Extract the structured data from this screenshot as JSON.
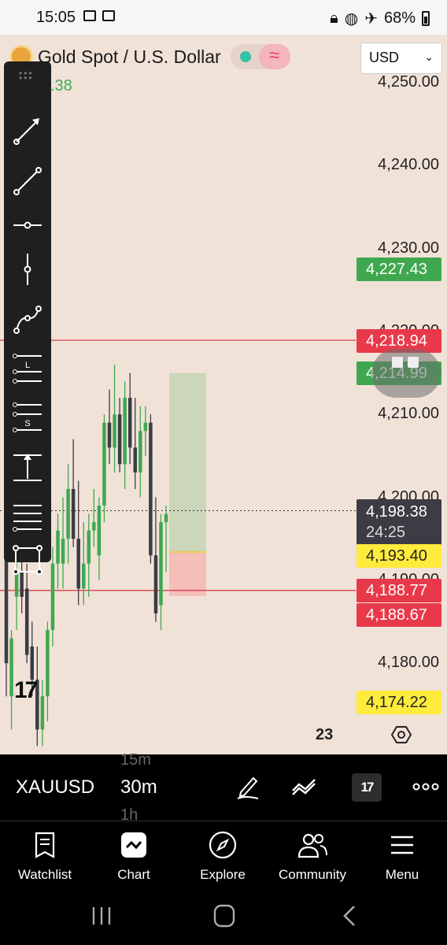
{
  "status_bar": {
    "time": "15:05",
    "battery": "68%"
  },
  "header": {
    "symbol_name": "Gold Spot / U.S. Dollar",
    "currency": "USD",
    "ohlc_fragment": ".38"
  },
  "price_axis": [
    "4,250.00",
    "4,240.00",
    "4,230.00",
    "4,220.00",
    "4,210.00",
    "4,200.00",
    "4,190.00",
    "4,180.00"
  ],
  "price_tags": {
    "tp_price": "4,227.43",
    "red_line_upper": "4,218.94",
    "green_level": "4,214.99",
    "last_price": "4,198.38",
    "countdown": "24:25",
    "entry": "4,193.40",
    "red_line_lower": "4,188.77",
    "stop": "4,188.67",
    "low_level": "4,174.22"
  },
  "chart_data": {
    "type": "candlestick",
    "symbol": "XAUUSD",
    "timeframe": "30m",
    "ylim": [
      4170,
      4252
    ],
    "horizontal_lines": [
      4218.94,
      4188.77
    ],
    "last_price": 4198.38,
    "candles": [
      {
        "o": 4200,
        "h": 4203,
        "l": 4176,
        "c": 4180
      },
      {
        "o": 4176,
        "h": 4184,
        "l": 4172,
        "c": 4183
      },
      {
        "o": 4188,
        "h": 4196,
        "l": 4184,
        "c": 4191
      },
      {
        "o": 4191,
        "h": 4195,
        "l": 4186,
        "c": 4188
      },
      {
        "o": 4189,
        "h": 4192,
        "l": 4180,
        "c": 4181
      },
      {
        "o": 4182,
        "h": 4185,
        "l": 4176,
        "c": 4178
      },
      {
        "o": 4178,
        "h": 4182,
        "l": 4170,
        "c": 4172
      },
      {
        "o": 4172,
        "h": 4178,
        "l": 4170,
        "c": 4176
      },
      {
        "o": 4176,
        "h": 4185,
        "l": 4173,
        "c": 4184
      },
      {
        "o": 4184,
        "h": 4194,
        "l": 4182,
        "c": 4192
      },
      {
        "o": 4192,
        "h": 4198,
        "l": 4189,
        "c": 4196
      },
      {
        "o": 4192,
        "h": 4200,
        "l": 4189,
        "c": 4195
      },
      {
        "o": 4195,
        "h": 4204,
        "l": 4192,
        "c": 4201
      },
      {
        "o": 4201,
        "h": 4207,
        "l": 4194,
        "c": 4195
      },
      {
        "o": 4195,
        "h": 4202,
        "l": 4187,
        "c": 4189
      },
      {
        "o": 4189,
        "h": 4197,
        "l": 4187,
        "c": 4192
      },
      {
        "o": 4192,
        "h": 4198,
        "l": 4188,
        "c": 4196
      },
      {
        "o": 4196,
        "h": 4201,
        "l": 4194,
        "c": 4197
      },
      {
        "o": 4193,
        "h": 4200,
        "l": 4190,
        "c": 4199
      },
      {
        "o": 4199,
        "h": 4210,
        "l": 4197,
        "c": 4209
      },
      {
        "o": 4209,
        "h": 4213,
        "l": 4204,
        "c": 4206
      },
      {
        "o": 4206,
        "h": 4216,
        "l": 4203,
        "c": 4210
      },
      {
        "o": 4210,
        "h": 4212,
        "l": 4203,
        "c": 4204
      },
      {
        "o": 4204,
        "h": 4214,
        "l": 4201,
        "c": 4212
      },
      {
        "o": 4212,
        "h": 4215,
        "l": 4204,
        "c": 4206
      },
      {
        "o": 4206,
        "h": 4212,
        "l": 4201,
        "c": 4203
      },
      {
        "o": 4203,
        "h": 4211,
        "l": 4200,
        "c": 4208
      },
      {
        "o": 4208,
        "h": 4211,
        "l": 4205,
        "c": 4209
      },
      {
        "o": 4209,
        "h": 4210,
        "l": 4192,
        "c": 4193
      },
      {
        "o": 4193,
        "h": 4200,
        "l": 4185,
        "c": 4186
      },
      {
        "o": 4187,
        "h": 4198,
        "l": 4184,
        "c": 4197
      },
      {
        "o": 4197,
        "h": 4199,
        "l": 4191,
        "c": 4198
      }
    ],
    "position": {
      "target": 4214.99,
      "entry": 4193.4,
      "stop": 4188.67
    }
  },
  "toolbar": {
    "tools": [
      "trend-angle",
      "trend-line",
      "horizontal-line",
      "vertical-line",
      "path",
      "long-position",
      "short-position",
      "fixed-range-volume",
      "parallel-channel",
      "rectangle"
    ],
    "long_label": "L",
    "short_label": "S"
  },
  "chart_footer": {
    "count": "23",
    "logo": "17"
  },
  "bottom_bar": {
    "symbol": "XAUUSD",
    "timeframe": "30m",
    "timeframe_prev": "15m",
    "timeframe_next": "1h",
    "tv_button": "17"
  },
  "tabs": [
    "Watchlist",
    "Chart",
    "Explore",
    "Community",
    "Menu"
  ]
}
